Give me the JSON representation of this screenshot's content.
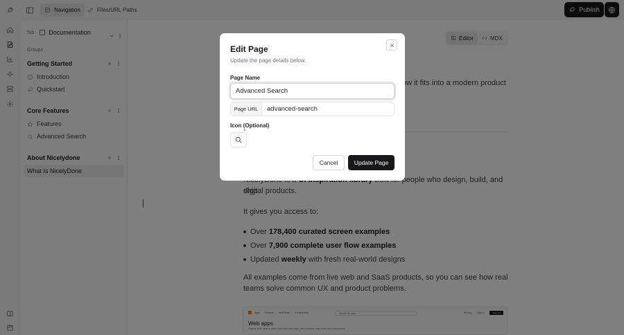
{
  "topbar": {
    "tabs": [
      {
        "label": "Navigation",
        "icon": "navigation-icon",
        "active": true
      },
      {
        "label": "Files/URL Paths",
        "icon": "link-icon",
        "active": false
      }
    ],
    "publish_label": "Publish"
  },
  "sidebar": {
    "tab_label": "Tab",
    "tab_value": "Documentation",
    "groups_label": "Groups",
    "groups": [
      {
        "label": "Getting Started",
        "pages": [
          "Introduction",
          "Quickstart"
        ]
      },
      {
        "label": "Core Features",
        "pages": [
          "Features",
          "Advanced Search"
        ]
      },
      {
        "label": "About Nicelydone",
        "pages": [
          "What Is NicelyDone"
        ]
      }
    ]
  },
  "editor": {
    "modes": [
      {
        "label": "Editor",
        "active": true
      },
      {
        "label": "MDX",
        "active": false
      }
    ],
    "partial_line_right": "ow it fits into a modern product",
    "intro_prefix": "NicelyDone is a ",
    "intro_bold": "UI inspiration library",
    "intro_suffix": " built for people who design, build, and ship",
    "intro_line2": "digital products.",
    "access_text": "It gives you access to:",
    "bullets": [
      {
        "pre": "Over ",
        "bold": "178,400 curated screen examples",
        "post": ""
      },
      {
        "pre": "Over ",
        "bold": "7,900 complete user flow examples",
        "post": ""
      },
      {
        "pre": "Updated ",
        "bold": "weekly",
        "post": " with fresh real-world designs"
      }
    ],
    "closing_line1": "All examples come from live web and SaaS products, so you can see how real",
    "closing_line2": "teams solve common UX and product problems.",
    "preview": {
      "nav": [
        "Apps",
        "Screens",
        "User flows",
        "Components"
      ],
      "search_placeholder": "Search for apps",
      "right": [
        "Pricing",
        "Sign in"
      ],
      "join": "Join now",
      "title": "Web apps",
      "subtitle": "Explore 620+ best in class SaaS and web apps, their screens, user flows and components."
    }
  },
  "dialog": {
    "title": "Edit Page",
    "description": "Update the page details below.",
    "name_label": "Page Name",
    "name_value": "Advanced Search",
    "url_label": "Page URL",
    "url_value": "advanced-search",
    "icon_label": "Icon (Optional)",
    "icon_name": "search-icon",
    "remove_icon_glyph": "×",
    "cancel_label": "Cancel",
    "submit_label": "Update Page"
  }
}
